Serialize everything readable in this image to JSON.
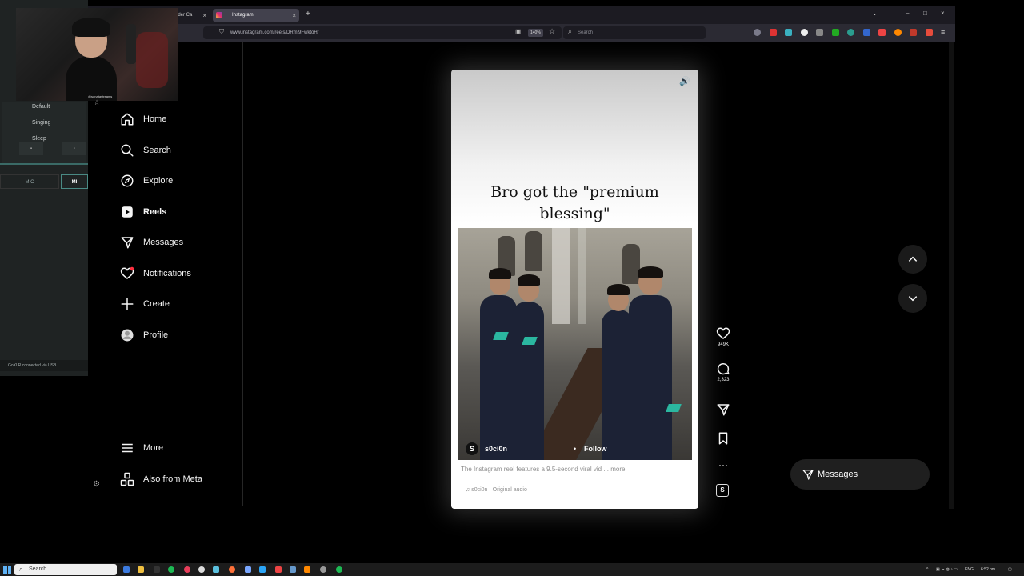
{
  "leftapp": {
    "presets": [
      "Default",
      "Singing",
      "Sleep"
    ],
    "mic_tabs": [
      "MIC",
      "MI"
    ],
    "status": "GoXLR connected via USB"
  },
  "webcam": {
    "tag": "@sonatastreams"
  },
  "browser": {
    "tabs": [
      {
        "label": "Murder Ca",
        "active": false
      },
      {
        "label": "Instagram",
        "active": true
      }
    ],
    "url": "www.instagram.com/reels/DRmi9FwktoH/",
    "zoom": "140%",
    "search_placeholder": "Search",
    "extension_colors": [
      "#7a7a8a",
      "#d33",
      "#3ab0c0",
      "#eee",
      "#888",
      "#2a2",
      "#2a9d8f",
      "#36c",
      "#e44",
      "#f80",
      "#c0392b",
      "#e74c3c"
    ]
  },
  "sidebar": {
    "items": [
      {
        "label": "Home",
        "icon": "home-icon"
      },
      {
        "label": "Search",
        "icon": "search-icon"
      },
      {
        "label": "Explore",
        "icon": "compass-icon"
      },
      {
        "label": "Reels",
        "icon": "reels-icon",
        "active": true
      },
      {
        "label": "Messages",
        "icon": "send-icon"
      },
      {
        "label": "Notifications",
        "icon": "heart-icon"
      },
      {
        "label": "Create",
        "icon": "plus-icon"
      },
      {
        "label": "Profile",
        "icon": "avatar-icon"
      }
    ],
    "bottom": [
      {
        "label": "More",
        "icon": "menu-icon"
      },
      {
        "label": "Also from Meta",
        "icon": "meta-apps-icon"
      }
    ]
  },
  "reel": {
    "caption_line1": "Bro got the \"premium",
    "caption_line2": "blessing\"",
    "username": "s0ci0n",
    "follow": "Follow",
    "dot": "•",
    "description": "The Instagram reel features a 9.5-second viral vid ...",
    "more": "more",
    "audio": "s0ci0n · Original audio",
    "avatar_letter": "S"
  },
  "actions": {
    "likes": "949K",
    "comments": "2,323"
  },
  "messages_pill": {
    "label": "Messages"
  },
  "taskbar": {
    "search": "Search",
    "lang": "ENG",
    "time": "6:52 pm"
  },
  "colors": {
    "accent_notification": "#ff3040",
    "page_bg": "#000000"
  }
}
